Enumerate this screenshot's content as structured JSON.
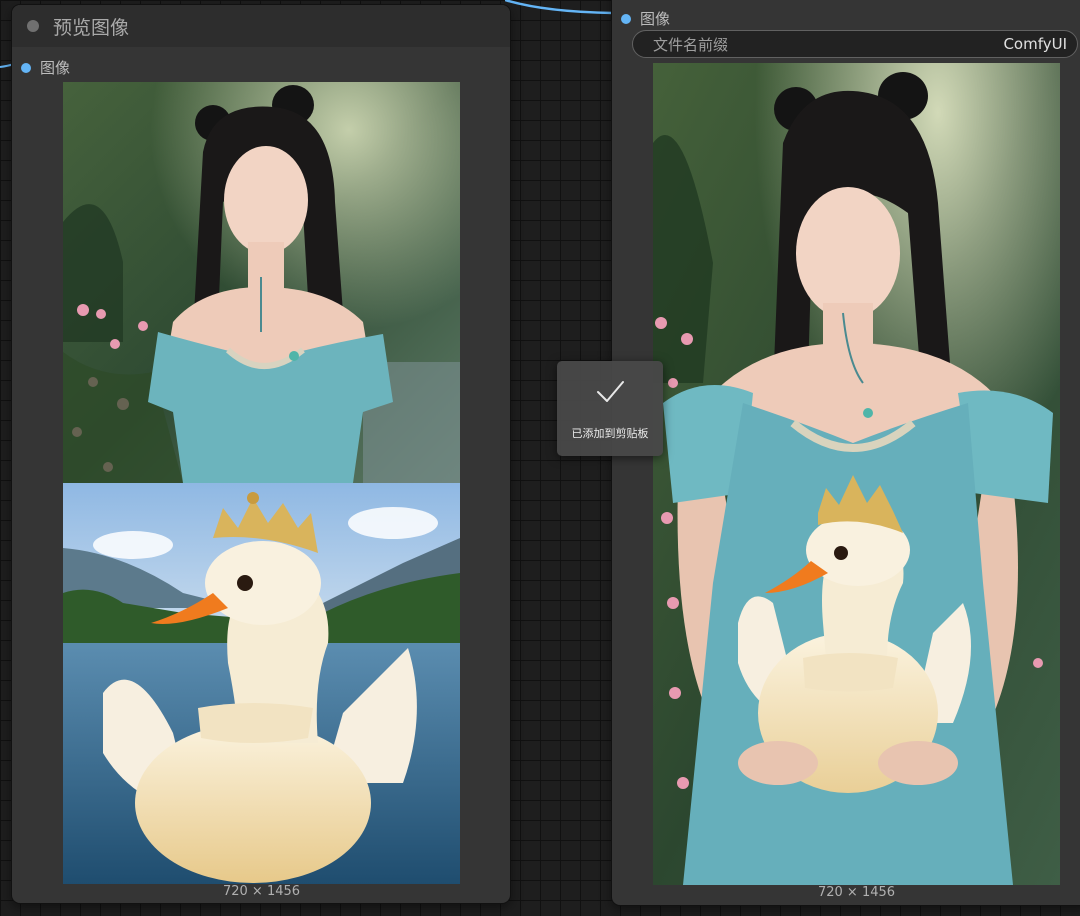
{
  "left_node": {
    "title": "预览图像",
    "slot_label": "图像",
    "image_size": "720 × 1456"
  },
  "right_node": {
    "slot_label": "图像",
    "widget": {
      "label": "文件名前缀",
      "value": "ComfyUI"
    },
    "image_size": "720 × 1456"
  },
  "toast": {
    "message": "已添加到剪贴板",
    "icon": "checkmark-icon"
  },
  "colors": {
    "canvas": "#1e1e1e",
    "node_body": "#353535",
    "node_title": "#2d2d2d",
    "slot_dot": "#64b5f6",
    "wire": "#64b5f6"
  }
}
